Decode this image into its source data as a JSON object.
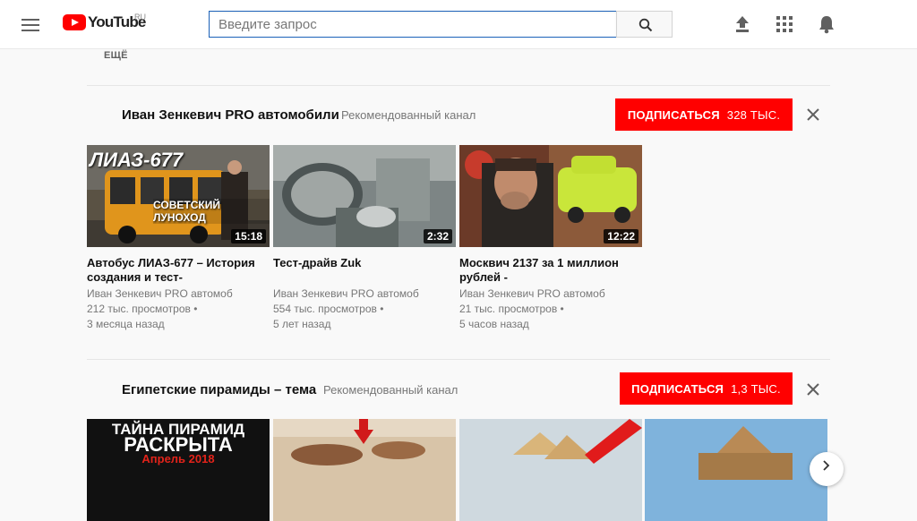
{
  "header": {
    "logo_text": "YouTube",
    "region": "RU",
    "search_placeholder": "Введите запрос"
  },
  "more_label": "ЕЩЁ",
  "shelves": [
    {
      "title": "Иван Зенкевич PRO автомобили",
      "subtitle": "Рекомендованный канал",
      "subscribe_label": "ПОДПИСАТЬСЯ",
      "subscriber_count": "328 ТЫС.",
      "videos": [
        {
          "title": "Автобус ЛИАЗ-677 – История создания и тест-",
          "channel": "Иван Зенкевич PRO автомоб",
          "views": "212 тыс. просмотров •",
          "age": "3 месяца назад",
          "duration": "15:18",
          "thumb_text_1": "ЛИАЗ-677",
          "thumb_text_2": "СОВЕТСКИЙ ЛУНОХОД"
        },
        {
          "title": "Тест-драйв Zuk",
          "channel": "Иван Зенкевич PRO автомоб",
          "views": "554 тыс. просмотров •",
          "age": "5 лет назад",
          "duration": "2:32"
        },
        {
          "title": "Москвич 2137 за 1 миллион рублей -",
          "channel": "Иван Зенкевич PRO автомоб",
          "views": "21 тыс. просмотров •",
          "age": "5 часов назад",
          "duration": "12:22"
        }
      ]
    },
    {
      "title": "Египетские пирамиды – тема",
      "subtitle": "Рекомендованный канал",
      "subscribe_label": "ПОДПИСАТЬСЯ",
      "subscriber_count": "1,3 ТЫС.",
      "videos": [
        {
          "thumb_text_1": "ТАЙНА ПИРАМИД",
          "thumb_text_2": "РАСКРЫТА",
          "thumb_text_3": "Апрель 2018"
        },
        {},
        {},
        {}
      ]
    }
  ],
  "colors": {
    "brand": "#ff0000",
    "search_border": "#1c62b9"
  }
}
